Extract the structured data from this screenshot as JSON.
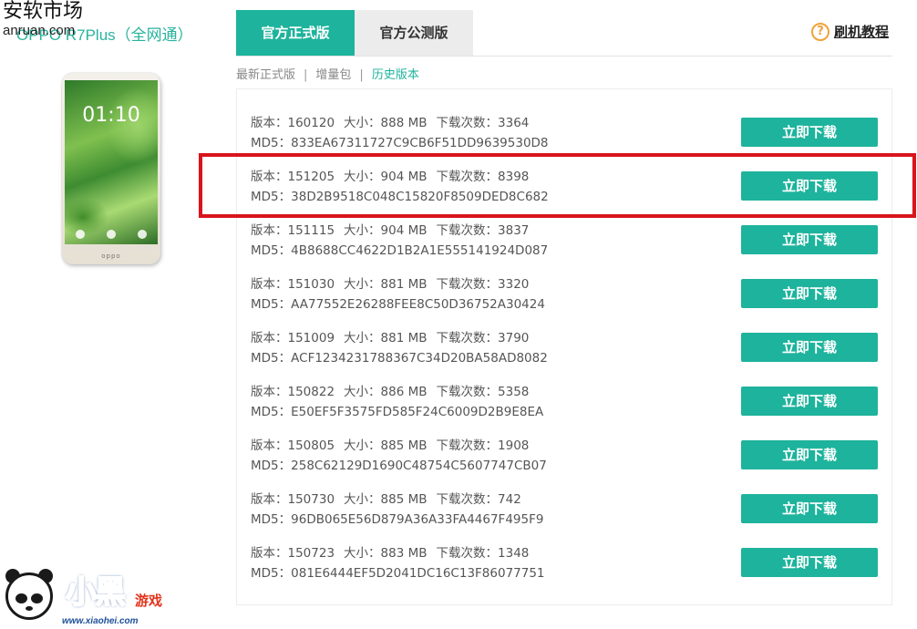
{
  "watermark_top": {
    "line1": "安软市场",
    "line2": "anruan.com"
  },
  "device": {
    "title": "OPPO R7Plus（全网通）",
    "phone_clock": "01:10",
    "phone_brand": "oppo"
  },
  "tabs": [
    {
      "label": "官方正式版",
      "active": true
    },
    {
      "label": "官方公测版",
      "active": false
    }
  ],
  "help": {
    "icon": "question-circle-icon",
    "label": "刷机教程"
  },
  "subnav": [
    {
      "label": "最新正式版"
    },
    {
      "label": "增量包"
    },
    {
      "label": "历史版本",
      "current": true
    }
  ],
  "labels": {
    "version": "版本：",
    "size": "大小：",
    "downloads": "下载次数：",
    "md5": "MD5："
  },
  "rows": [
    {
      "version": "160120",
      "size": "888 MB",
      "downloads": "3364",
      "md5": "833EA67311727C9CB6F51DD9639530D8",
      "button": "立即下载"
    },
    {
      "version": "151205",
      "size": "904 MB",
      "downloads": "8398",
      "md5": "38D2B9518C048C15820F8509DED8C682",
      "button": "立即下载"
    },
    {
      "version": "151115",
      "size": "904 MB",
      "downloads": "3837",
      "md5": "4B8688CC4622D1B2A1E555141924D087",
      "button": "立即下载"
    },
    {
      "version": "151030",
      "size": "881 MB",
      "downloads": "3320",
      "md5": "AA77552E26288FEE8C50D36752A30424",
      "button": "立即下载"
    },
    {
      "version": "151009",
      "size": "881 MB",
      "downloads": "3790",
      "md5": "ACF1234231788367C34D20BA58AD8082",
      "button": "立即下载"
    },
    {
      "version": "150822",
      "size": "886 MB",
      "downloads": "5358",
      "md5": "E50EF5F3575FD585F24C6009D2B9E8EA",
      "button": "立即下载"
    },
    {
      "version": "150805",
      "size": "885 MB",
      "downloads": "1908",
      "md5": "258C62129D1690C48754C5607747CB07",
      "button": "立即下载"
    },
    {
      "version": "150730",
      "size": "885 MB",
      "downloads": "742",
      "md5": "96DB065E56D879A36A33FA4467F495F9",
      "button": "立即下载"
    },
    {
      "version": "150723",
      "size": "883 MB",
      "downloads": "1348",
      "md5": "081E6444EF5D2041DC16C13F86077751",
      "button": "立即下载"
    }
  ],
  "watermark_bottom": {
    "brand": "小黑",
    "brand_small": "游戏",
    "url": "www.xiaohei.com"
  },
  "colors": {
    "accent": "#1eb39c",
    "highlight": "#d9141b",
    "help": "#f0a23b"
  }
}
